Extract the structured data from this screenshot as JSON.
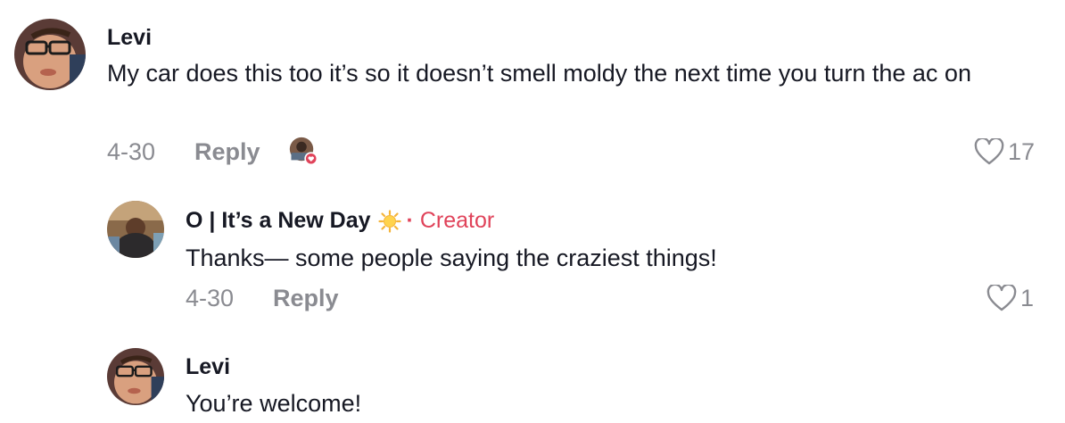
{
  "comments": [
    {
      "username": "Levi",
      "text": "My car does this too it’s so it doesn’t smell moldy the next time you turn the ac on",
      "date": "4-30",
      "reply_label": "Reply",
      "likes": "17",
      "creator_liked": true
    }
  ],
  "replies": [
    {
      "username": "O | It’s a New Day",
      "badge_separator": "·",
      "badge": "Creator",
      "text": "Thanks— some people saying the craziest things!",
      "date": "4-30",
      "reply_label": "Reply",
      "likes": "1"
    },
    {
      "username": "Levi",
      "text": "You’re welcome!"
    }
  ],
  "colors": {
    "accent": "#e0435a",
    "muted": "#8a8b91",
    "text": "#161823"
  }
}
